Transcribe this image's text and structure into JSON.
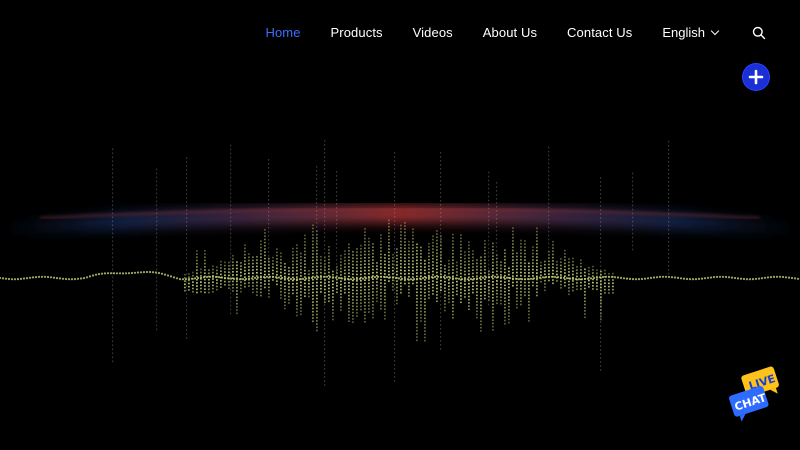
{
  "nav": {
    "items": [
      {
        "label": "Home",
        "active": true
      },
      {
        "label": "Products",
        "active": false
      },
      {
        "label": "Videos",
        "active": false
      },
      {
        "label": "About Us",
        "active": false
      },
      {
        "label": "Contact Us",
        "active": false
      }
    ],
    "language": "English",
    "active_color": "#3b6cff"
  },
  "icons": {
    "search": "search-icon",
    "language_dropdown": "chevron-down-icon",
    "floating_action": "plus-icon",
    "chat": "live-chat-icon"
  },
  "live_chat": {
    "line1": "LIVE",
    "line2": "CHAT"
  },
  "colors": {
    "background": "#000000",
    "plus_button": "#1a2fd6",
    "waveform": "#c8d27a",
    "glow": "#b33a3a"
  }
}
